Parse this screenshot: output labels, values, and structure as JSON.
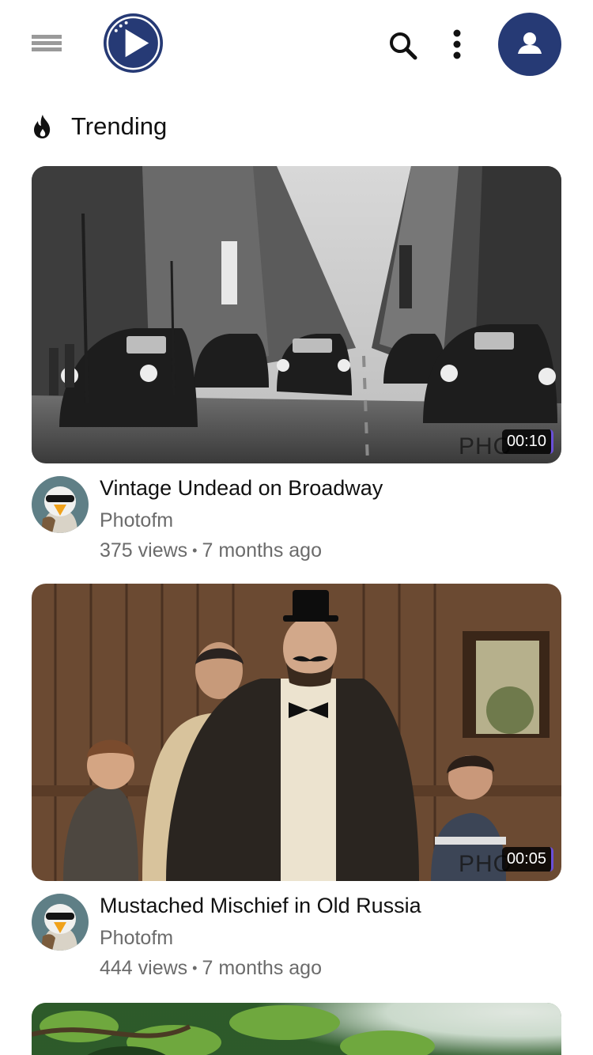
{
  "header": {
    "menu_icon": "hamburger-menu-icon",
    "logo_icon": "play-logo-icon",
    "search_icon": "search-icon",
    "more_icon": "more-vertical-icon",
    "account_icon": "user-avatar-icon",
    "brand_color": "#263a75"
  },
  "section": {
    "icon": "fire-icon",
    "title": "Trending"
  },
  "videos": [
    {
      "title": "Vintage Undead on Broadway",
      "channel": "Photofm",
      "views": "375 views",
      "age": "7 months ago",
      "duration": "00:10",
      "watermark": "PHO"
    },
    {
      "title": "Mustached Mischief in Old Russia",
      "channel": "Photofm",
      "views": "444 views",
      "age": "7 months ago",
      "duration": "00:05",
      "watermark": "PHO"
    }
  ],
  "separator": "•"
}
